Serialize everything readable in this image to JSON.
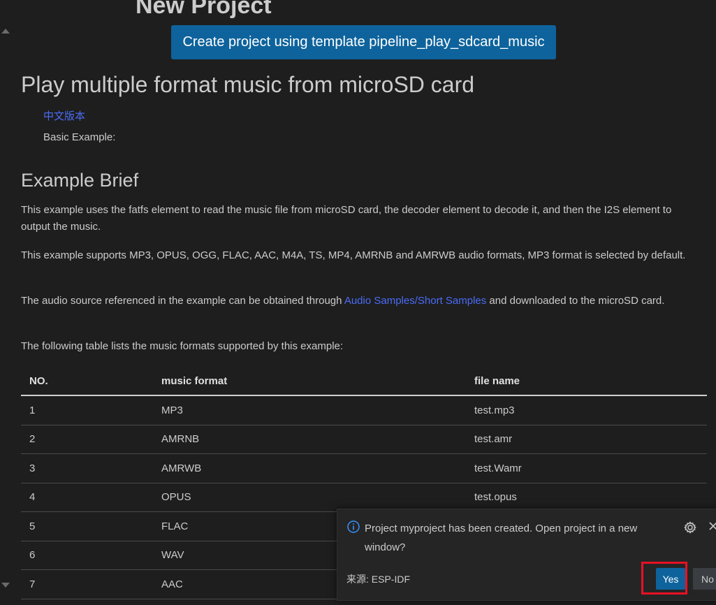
{
  "page": {
    "heading": "New Project",
    "create_button_label": "Create project using template pipeline_play_sdcard_music"
  },
  "doc": {
    "title": "Play multiple format music from microSD card",
    "cn_link_label": "中文版本",
    "basic_example": "Basic Example:",
    "section_title": "Example Brief",
    "paragraph1": "This example uses the fatfs element to read the music file from microSD card, the decoder element to decode it, and then the I2S element to output the music.",
    "paragraph2": "This example supports MP3, OPUS, OGG, FLAC, AAC, M4A, TS, MP4, AMRNB and AMRWB audio formats, MP3 format is selected by default.",
    "paragraph3_before": "The audio source referenced in the example can be obtained through ",
    "paragraph3_link": "Audio Samples/Short Samples",
    "paragraph3_after": " and downloaded to the microSD card.",
    "paragraph4": "The following table lists the music formats supported by this example:"
  },
  "table": {
    "headers": [
      "NO.",
      "music format",
      "file name"
    ],
    "rows": [
      [
        "1",
        "MP3",
        "test.mp3"
      ],
      [
        "2",
        "AMRNB",
        "test.amr"
      ],
      [
        "3",
        "AMRWB",
        "test.Wamr"
      ],
      [
        "4",
        "OPUS",
        "test.opus"
      ],
      [
        "5",
        "FLAC",
        ""
      ],
      [
        "6",
        "WAV",
        ""
      ],
      [
        "7",
        "AAC",
        ""
      ]
    ]
  },
  "notification": {
    "message": "Project myproject has been created. Open project in a new window?",
    "source": "来源: ESP-IDF",
    "yes_label": "Yes",
    "no_label": "No",
    "icons": [
      "info-icon",
      "gear-icon",
      "close-icon"
    ]
  },
  "colors": {
    "background": "#1e1e1e",
    "accent_button": "#0e639c",
    "link": "#4a6cf7",
    "highlight": "#e81123"
  }
}
